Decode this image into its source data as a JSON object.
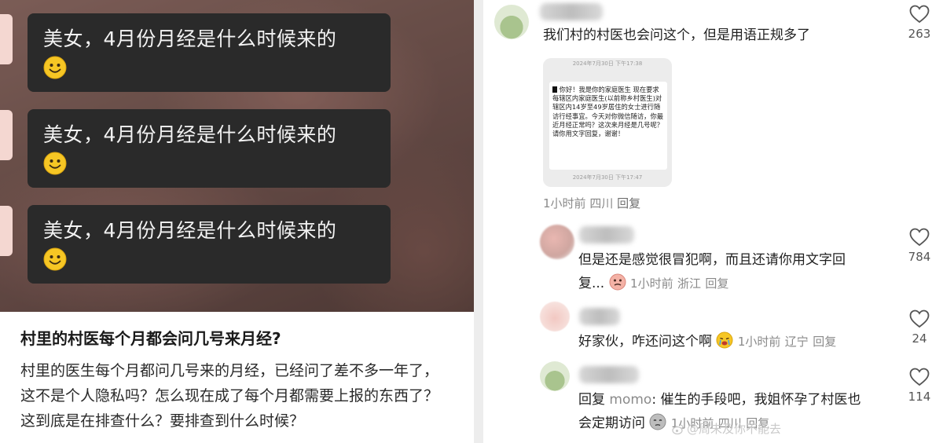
{
  "post": {
    "bubbles": [
      "美女，4月份月经是什么时候来的",
      "美女，4月份月经是什么时候来的",
      "美女，4月份月经是什么时候来的"
    ],
    "title": "村里的村医每个月都会问几号来月经?",
    "body": "村里的医生每个月都问几号来的月经，已经问了差不多一年了，这不是个人隐私吗？怎么现在成了每个月都需要上报的东西了？这到底是在排查什么？要排查到什么时候？"
  },
  "comments": [
    {
      "text": "我们村的村医也会问这个，但是用语正规多了",
      "time": "1小时前",
      "location": "四川",
      "reply": "回复",
      "likes": "263",
      "screenshot": {
        "time_top": "2024年7月30日 下午17:38",
        "message": "你好！我是你的家庭医生 现在要求每辖区内家庭医生(以前称乡村医生)对辖区内14岁至49岁居住的女士进行随访行经事宜。今天对你微信随访，你最近月经正常吗？这次来月经是几号呢？请你用文字回复，谢谢！",
        "time_bottom": "2024年7月30日 下午17:47"
      }
    },
    {
      "text_line1": "但是还是感觉很冒犯啊，而且还请你用文字回",
      "text_line2": "复...",
      "time": "1小时前",
      "location": "浙江",
      "reply": "回复",
      "likes": "784"
    },
    {
      "text": "好家伙，咋还问这个啊",
      "time": "1小时前",
      "location": "辽宁",
      "reply": "回复",
      "likes": "24"
    },
    {
      "reply_prefix": "回复",
      "mention": "momo",
      "text_line1": ": 催生的手段吧，我姐怀孕了村医也",
      "text_line2": "会定期访问",
      "time": "1小时前",
      "location": "四川",
      "reply": "回复",
      "likes": "114"
    }
  ],
  "watermark": "@周末及你不能去",
  "colors": {
    "bubble": "#2a2a2a",
    "meta": "#8a8a8a",
    "divider": "#ededed"
  }
}
